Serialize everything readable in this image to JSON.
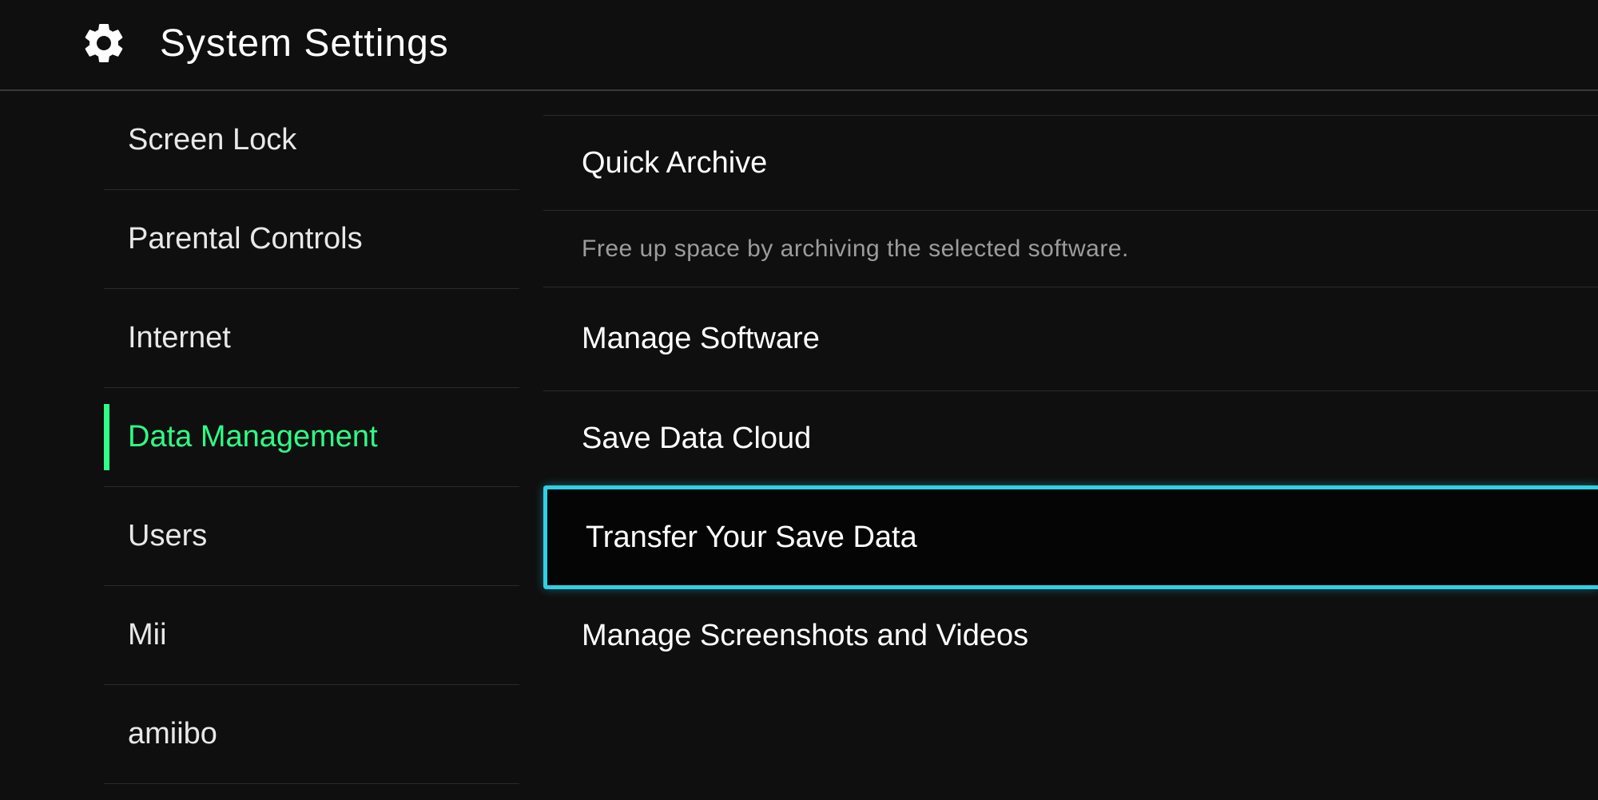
{
  "header": {
    "title": "System Settings"
  },
  "sidebar": {
    "items": [
      {
        "label": "Screen Lock",
        "active": false
      },
      {
        "label": "Parental Controls",
        "active": false
      },
      {
        "label": "Internet",
        "active": false
      },
      {
        "label": "Data Management",
        "active": true
      },
      {
        "label": "Users",
        "active": false
      },
      {
        "label": "Mii",
        "active": false
      },
      {
        "label": "amiibo",
        "active": false
      }
    ]
  },
  "main": {
    "rows": [
      {
        "label": "Quick Archive"
      },
      {
        "label": "Manage Software"
      },
      {
        "label": "Save Data Cloud"
      },
      {
        "label": "Transfer Your Save Data"
      },
      {
        "label": "Manage Screenshots and Videos"
      }
    ],
    "archive_desc": "Free up space by archiving the selected software."
  },
  "colors": {
    "accent": "#2dff87",
    "highlight": "#2fd0e6",
    "background": "#0f0f0f",
    "text": "#e8e8e8",
    "muted": "#9c9c9c"
  }
}
